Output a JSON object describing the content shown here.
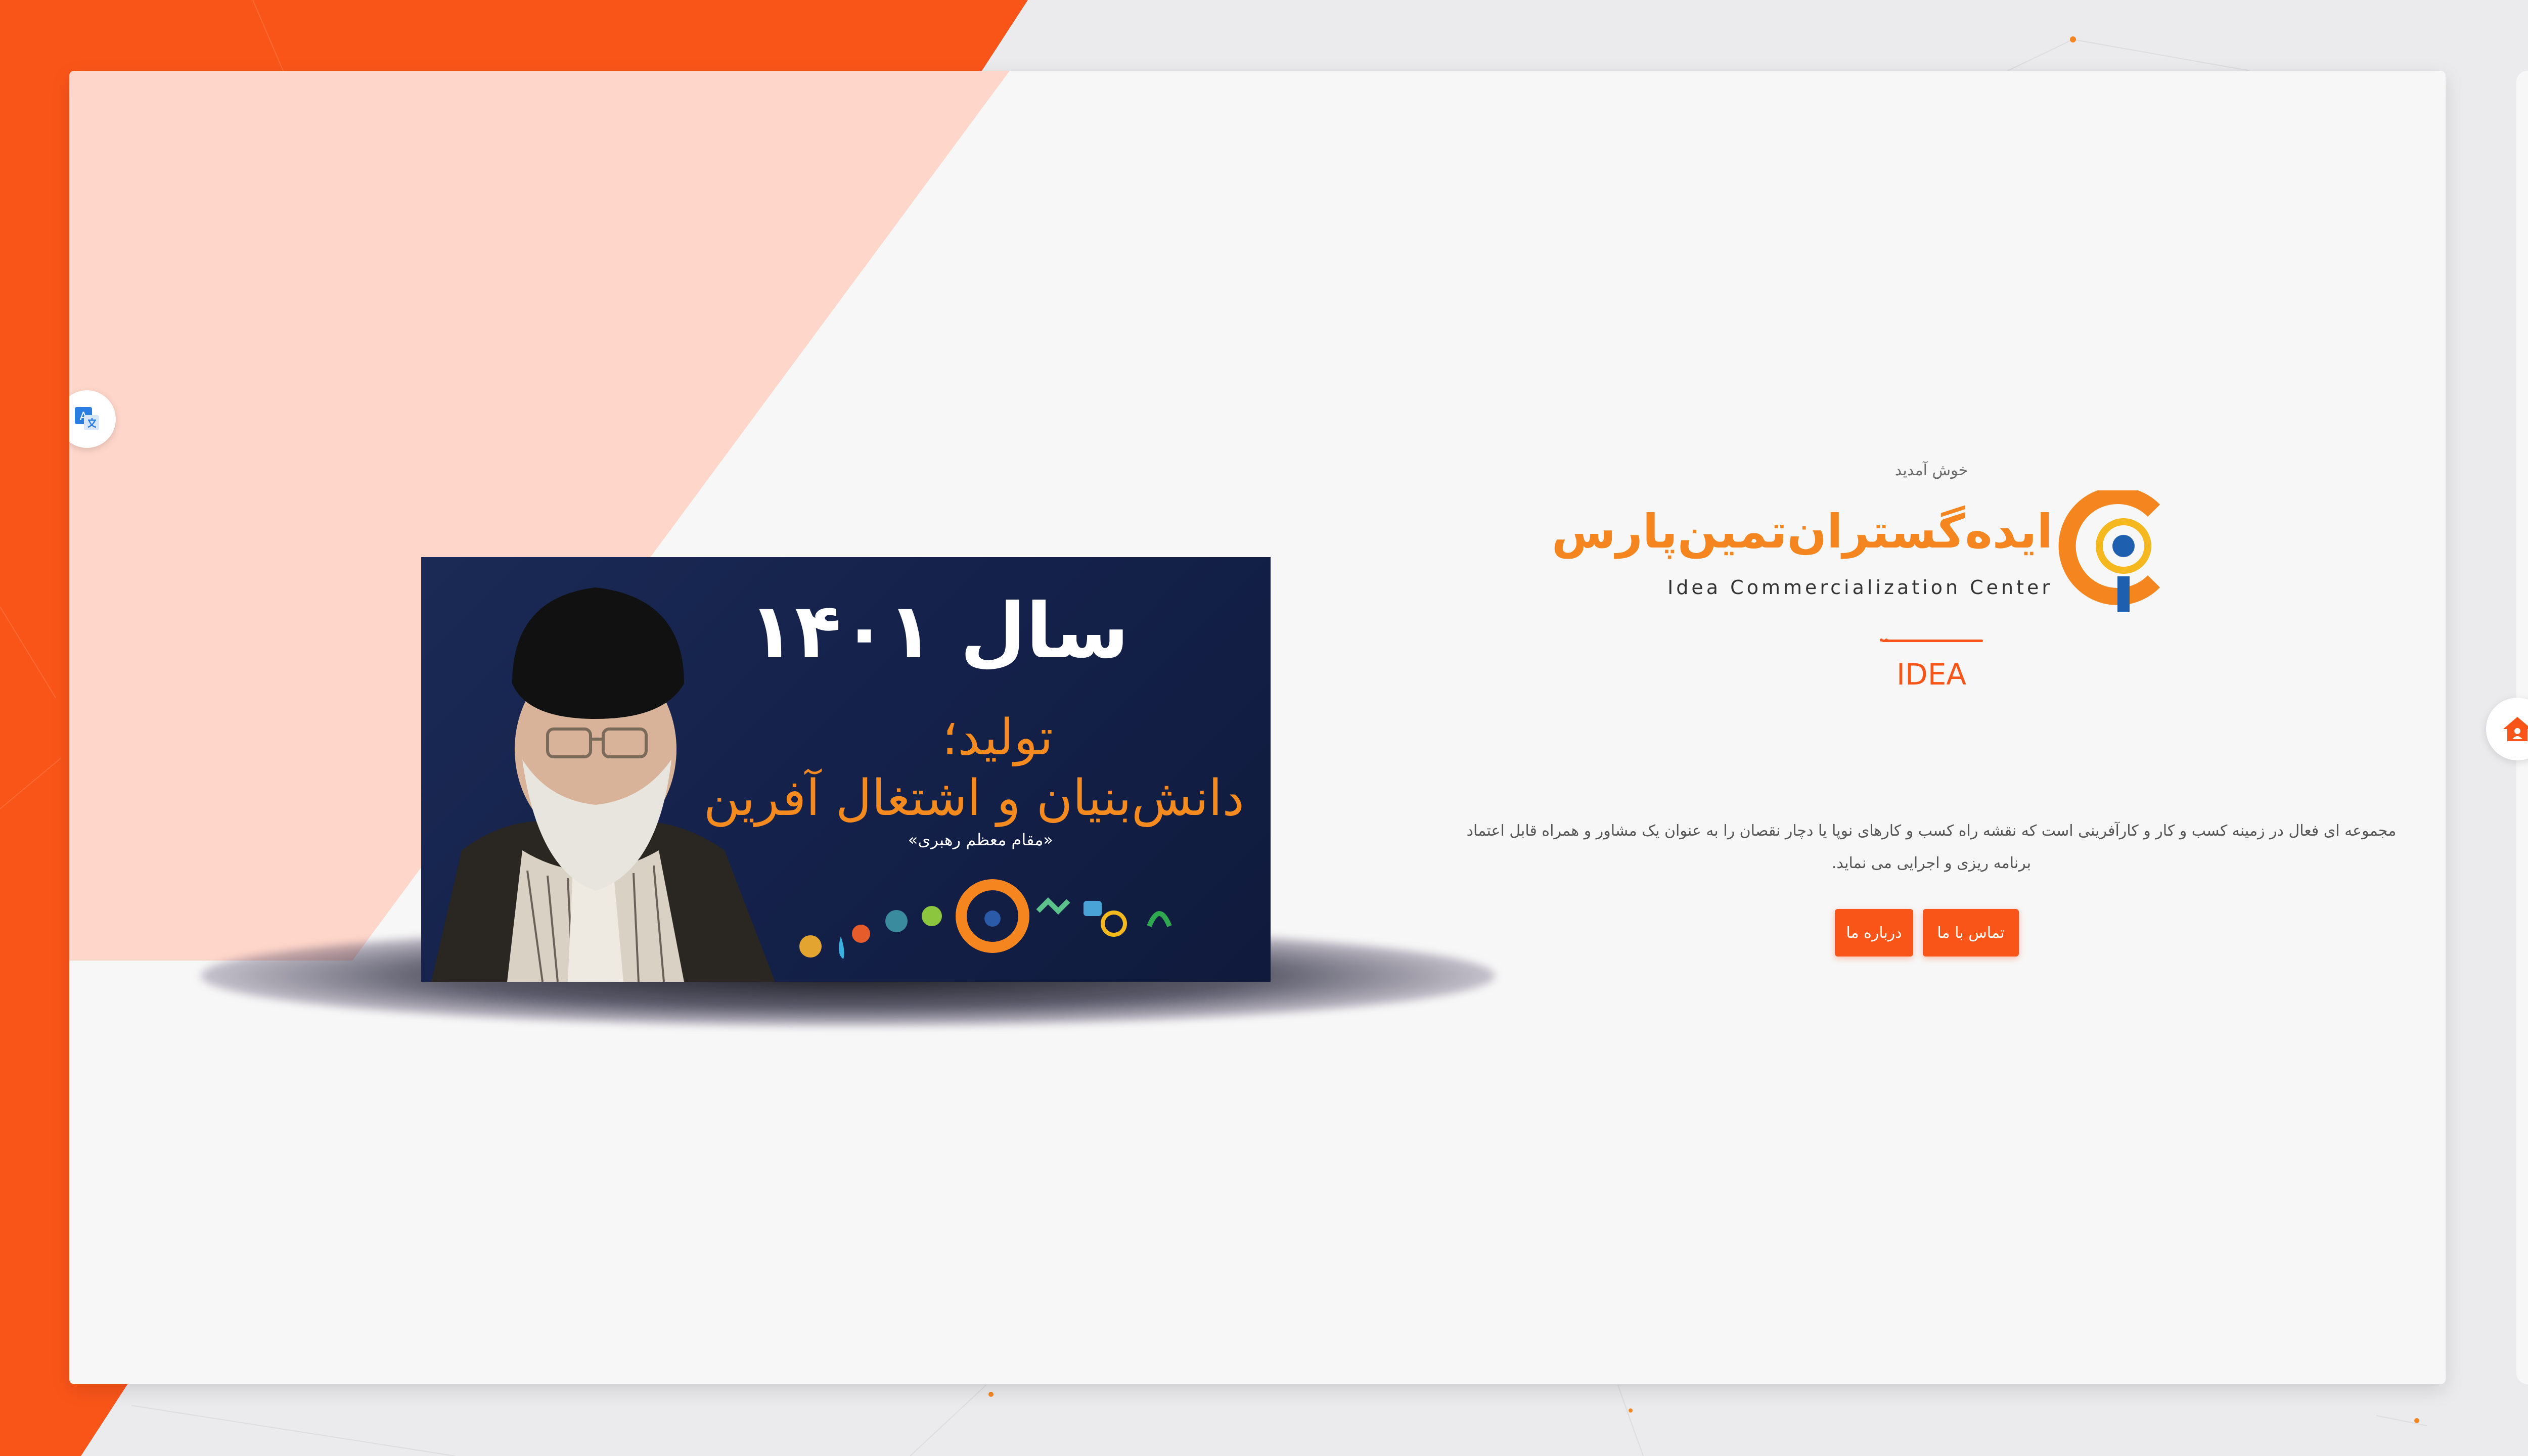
{
  "colors": {
    "accent": "#fa5519",
    "brand_orange": "#f5861f",
    "banner_navy": "#14214a",
    "card_bg": "#f7f7f7"
  },
  "hero": {
    "welcome": "خوش آمدید",
    "brand_name_fa": "ایده‌گستران‌تمین‌پارس",
    "brand_name_en": "Idea Commercialization Center",
    "tagline": "IDEA",
    "description": "مجموعه ای فعال در زمینه کسب و کار و کارآفرینی است که نقشه راه کسب و کارهای نوپا یا دچار نقصان را به عنوان یک مشاور و همراه قابل اعتماد برنامه ریزی و اجرایی می نماید.",
    "contact_button": "تماس با ما",
    "about_button": "درباره ما"
  },
  "banner": {
    "title": "سال ۱۴۰۱",
    "line1": "تولید؛",
    "line2": "دانش‌بنیان و اشتغال آفرین",
    "quote_credit": "«مقام معظم رهبری»"
  },
  "side_nav": {
    "items": [
      {
        "name": "contact-card-icon"
      },
      {
        "name": "layers-icon"
      },
      {
        "name": "rss-icon"
      },
      {
        "name": "home-icon",
        "active": true
      },
      {
        "name": "gallery-icon"
      },
      {
        "name": "phone-icon"
      },
      {
        "name": "search-icon"
      }
    ]
  },
  "translate": {
    "icon": "translate-icon"
  }
}
